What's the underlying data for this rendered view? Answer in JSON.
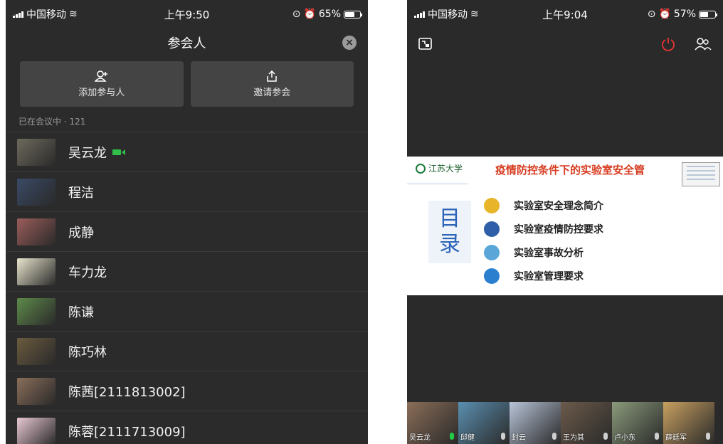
{
  "left_screen": {
    "status": {
      "carrier": "中国移动",
      "time": "上午9:50",
      "battery": "65%",
      "battery_level": 0.65
    },
    "header": {
      "title": "参会人",
      "close_icon": "close-icon"
    },
    "actions": [
      {
        "label": "添加参与人",
        "icon": "add-person-icon"
      },
      {
        "label": "邀请参会",
        "icon": "share-icon"
      }
    ],
    "section_label": "已在会议中 · 121",
    "members": [
      {
        "name": "吴云龙",
        "camera_on": true,
        "avatar_color": "#6d6a5c"
      },
      {
        "name": "程洁",
        "camera_on": false,
        "avatar_color": "#3a4a66"
      },
      {
        "name": "成静",
        "camera_on": false,
        "avatar_color": "#9a5d5a"
      },
      {
        "name": "车力龙",
        "camera_on": false,
        "avatar_color": "#e8e4cc"
      },
      {
        "name": "陈谦",
        "camera_on": false,
        "avatar_color": "#5e8a4a"
      },
      {
        "name": "陈巧林",
        "camera_on": false,
        "avatar_color": "#6b5a3e"
      },
      {
        "name": "陈茜[2111813002]",
        "camera_on": false,
        "avatar_color": "#8a6e5a"
      },
      {
        "name": "陈蓉[2111713009]",
        "camera_on": false,
        "avatar_color": "#e9c8d2"
      }
    ]
  },
  "right_screen": {
    "status": {
      "carrier": "中国移动",
      "time": "上午9:04",
      "battery": "57%",
      "battery_level": 0.57
    },
    "slide": {
      "logo_text": "江苏大学",
      "title": "疫情防控条件下的实验室安全管",
      "mulu_chars": [
        "目",
        "录"
      ],
      "items": [
        {
          "text": "实验室安全理念简介",
          "color": "#e8b52a"
        },
        {
          "text": "实验室疫情防控要求",
          "color": "#2f5fa8"
        },
        {
          "text": "实验室事故分析",
          "color": "#5aa6d8"
        },
        {
          "text": "实验室管理要求",
          "color": "#2a7fcf"
        }
      ]
    },
    "filmstrip": [
      {
        "name": "吴云龙",
        "mic_on": true,
        "color": "#8b6e58"
      },
      {
        "name": "邱健",
        "mic_on": false,
        "color": "#5a8fb0"
      },
      {
        "name": "封云",
        "mic_on": false,
        "color": "#b8c4d8"
      },
      {
        "name": "王为其",
        "mic_on": false,
        "color": "#6b5a4a"
      },
      {
        "name": "卢小东",
        "mic_on": false,
        "color": "#8a9a7a"
      },
      {
        "name": "薛廷军",
        "mic_on": false,
        "color": "#c8a060"
      }
    ]
  }
}
